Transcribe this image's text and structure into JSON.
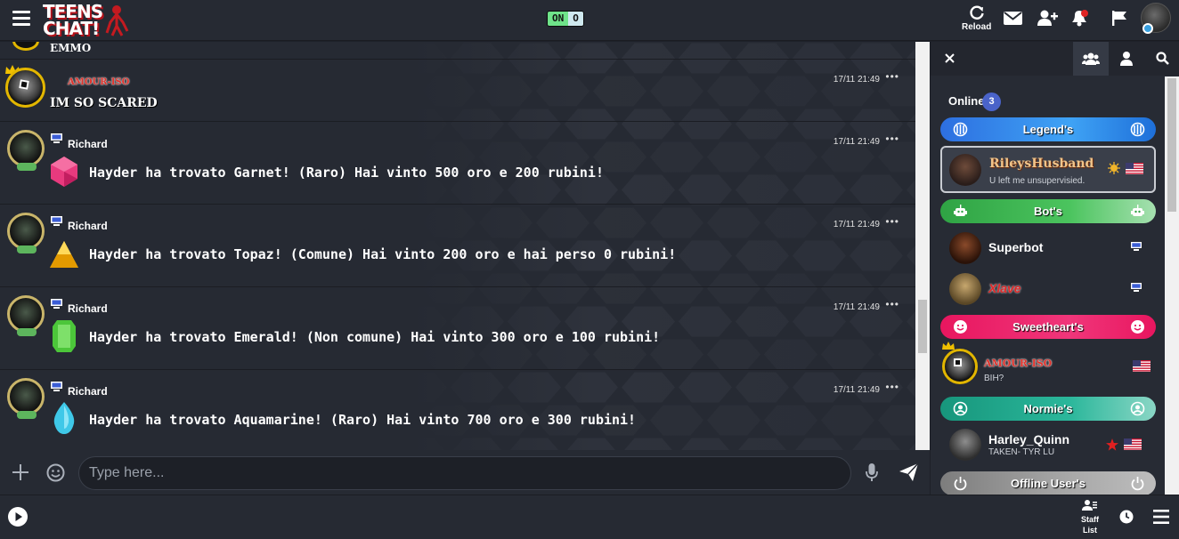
{
  "header": {
    "logo_line1": "TEENS",
    "logo_line2": "CHAT!",
    "toggle_on": "ON",
    "toggle_off": "O",
    "reload_label": "Reload",
    "icons": [
      "menu-icon",
      "reload-icon",
      "mail-icon",
      "add-user-icon",
      "notification-bell-icon",
      "flag-icon",
      "profile-avatar"
    ]
  },
  "chat": {
    "partial_top_name": "EMMO",
    "messages": [
      {
        "user": "AMOUR-ISO",
        "time": "17/11 21:49",
        "text": "IM SO SCARED",
        "options": "•••"
      },
      {
        "user": "Richard",
        "time": "17/11 21:49",
        "text": "Hayder ha trovato Garnet! (Raro) Hai vinto 500 oro e 200 rubini!",
        "gem": "pink-gem",
        "options": "•••"
      },
      {
        "user": "Richard",
        "time": "17/11 21:49",
        "text": "Hayder ha trovato Topaz! (Comune) Hai vinto 200 oro e hai perso 0 rubini!",
        "gem": "yellow-gem",
        "options": "•••"
      },
      {
        "user": "Richard",
        "time": "17/11 21:49",
        "text": "Hayder ha trovato Emerald! (Non comune) Hai vinto 300 oro e 100 rubini!",
        "gem": "green-gem",
        "options": "•••"
      },
      {
        "user": "Richard",
        "time": "17/11 21:49",
        "text": "Hayder ha trovato Aquamarine! (Raro) Hai vinto 700 oro e 300 rubini!",
        "gem": "blue-gem",
        "options": "•••"
      }
    ]
  },
  "input": {
    "placeholder": "Type here..."
  },
  "panel": {
    "online_label": "Online",
    "online_count": "3",
    "groups": {
      "legends": "Legend's",
      "bots": "Bot's",
      "sweethearts": "Sweetheart's",
      "normies": "Normie's",
      "offline": "Offline User's"
    },
    "users": {
      "rileys": {
        "name": "RileysHusband",
        "status": "U left me unsupervisied."
      },
      "superbot": {
        "name": "Superbot"
      },
      "xlave": {
        "name": "Xlave"
      },
      "amour": {
        "name": "AMOUR-ISO",
        "status": "BIH?"
      },
      "harley": {
        "name": "Harley_Quinn",
        "status": "TAKEN- TYR LU"
      }
    }
  },
  "footer": {
    "staff_label_1": "Staff",
    "staff_label_2": "List"
  },
  "colors": {
    "background": "#262a33",
    "legends": "#2f7be8",
    "bots": "#33b04a",
    "sweethearts": "#e81e63",
    "normies": "#1aa38a",
    "offline": "#9e9e9e",
    "amour_name": "#e0322b"
  }
}
